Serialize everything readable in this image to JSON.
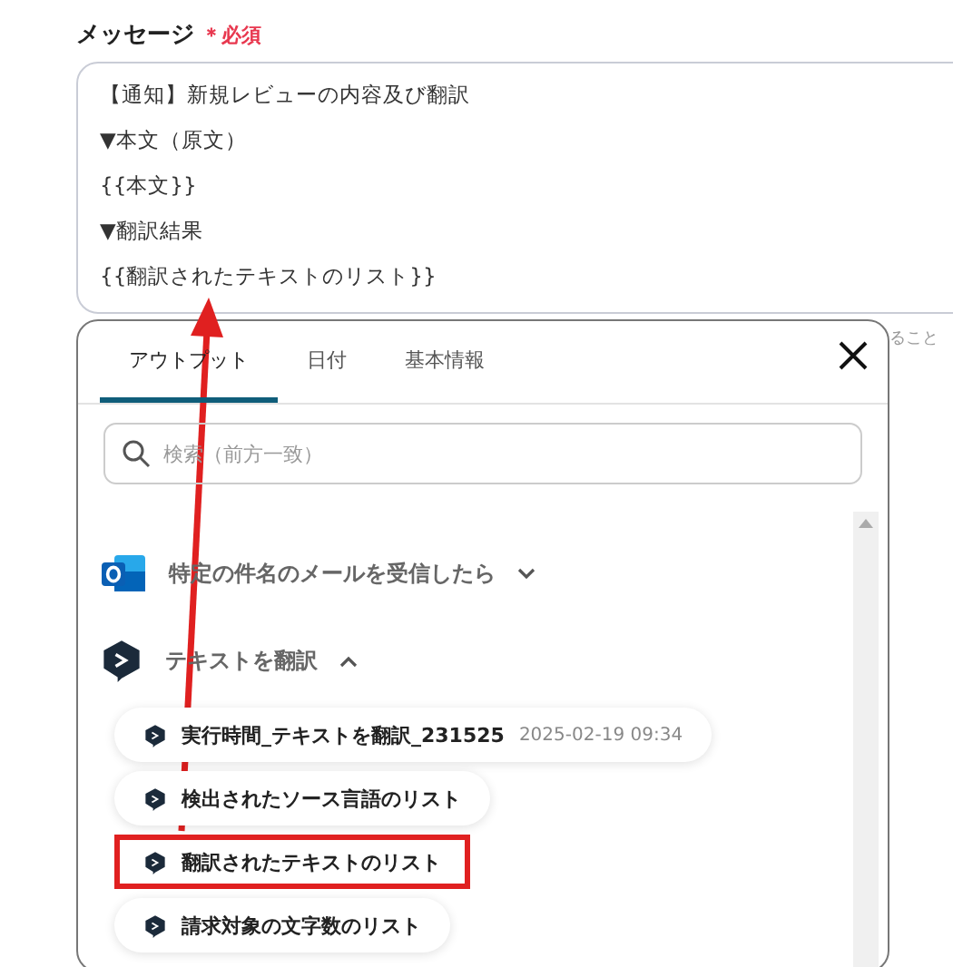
{
  "field": {
    "label": "メッセージ",
    "required_mark": "＊",
    "required_text": "必須",
    "lines": [
      "【通知】新規レビューの内容及び翻訳",
      "▼本文（原文）",
      "{{本文}}",
      "▼翻訳結果",
      "{{翻訳されたテキストのリスト}}"
    ]
  },
  "side_text": "ること",
  "panel": {
    "tabs": [
      {
        "label": "アウトプット",
        "selected": true
      },
      {
        "label": "日付",
        "selected": false
      },
      {
        "label": "基本情報",
        "selected": false
      }
    ],
    "search": {
      "placeholder": "検索（前方一致）"
    },
    "groups": [
      {
        "title": "特定の件名のメールを受信したら",
        "kind": "outlook",
        "expanded": false
      },
      {
        "title": "テキストを翻訳",
        "kind": "translate",
        "expanded": true,
        "items": [
          {
            "label": "実行時間_テキストを翻訳_231525",
            "timestamp": "2025-02-19 09:34",
            "highlighted": false
          },
          {
            "label": "検出されたソース言語のリスト",
            "highlighted": false
          },
          {
            "label": "翻訳されたテキストのリスト",
            "highlighted": true
          },
          {
            "label": "請求対象の文字数のリスト",
            "highlighted": false
          }
        ]
      }
    ]
  },
  "annotation": {
    "kind": "arrow"
  }
}
